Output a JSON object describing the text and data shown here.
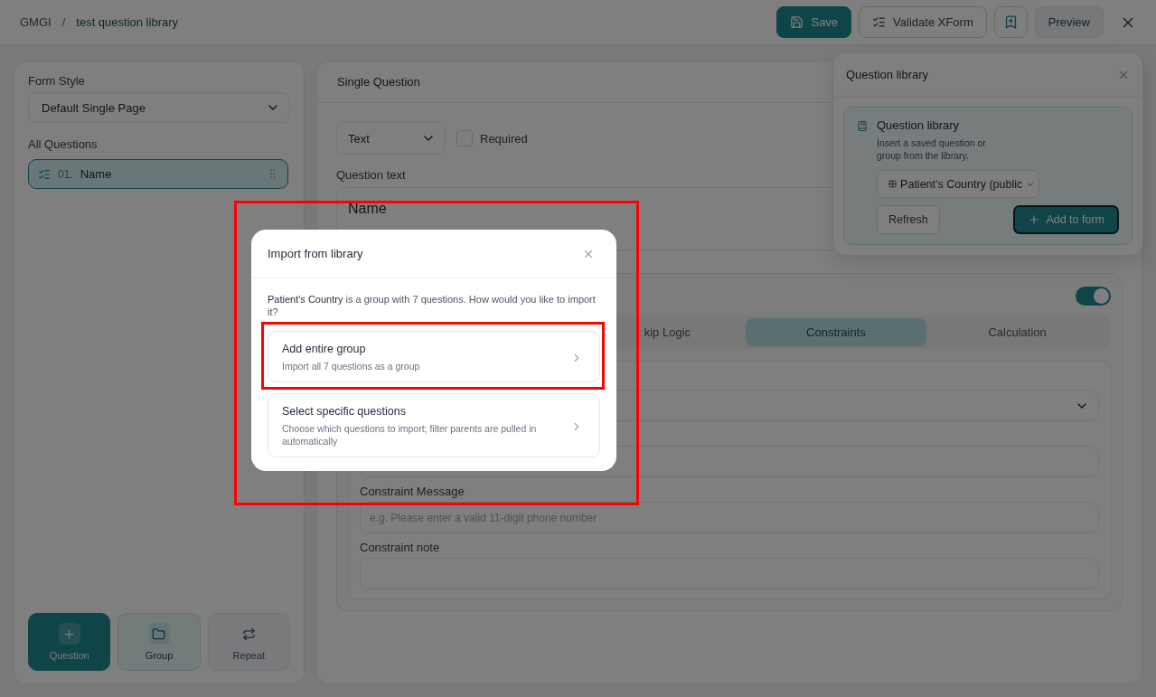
{
  "header": {
    "breadcrumb": [
      {
        "label": "GMGI",
        "current": false
      },
      {
        "label": "test question library",
        "current": true
      }
    ],
    "separator": "/",
    "actions": [
      {
        "kind": "primary",
        "label": "Save"
      },
      {
        "kind": "outline",
        "label": "Validate XForm"
      },
      {
        "kind": "icon"
      },
      {
        "kind": "soft",
        "label": "Preview"
      }
    ]
  },
  "sidebar": {
    "form_style_label": "Form Style",
    "form_style_value": "Default Single Page",
    "questions_label": "All Questions",
    "questions": [
      {
        "number": "01.",
        "label": "Name",
        "selected": true
      }
    ],
    "add_buttons": [
      {
        "kind": "primary",
        "label": "Question"
      },
      {
        "kind": "secondary",
        "label": "Group"
      },
      {
        "kind": "neutral",
        "label": "Repeat"
      }
    ]
  },
  "editor": {
    "title": "Single Question",
    "type_value": "Text",
    "required": {
      "label": "Required",
      "checked": false
    },
    "question_text_label": "Question text",
    "question_text_value": "Name",
    "logic_card": {
      "enabled": true,
      "tabs": [
        {
          "label": "kip Logic",
          "selected": false
        },
        {
          "label": "Constraints",
          "selected": true
        },
        {
          "label": "Calculation",
          "selected": false
        }
      ],
      "fields": [
        {
          "kind": "select"
        },
        {
          "kind": "input"
        },
        {
          "kind": "input",
          "label": "Constraint Message",
          "placeholder": "e.g. Please enter a valid 11-digit phone number"
        },
        {
          "kind": "input",
          "label": "Constraint note"
        }
      ]
    }
  },
  "library_popover": {
    "title": "Question library",
    "card_title": "Question library",
    "description": "Insert a saved question or group from the library.",
    "selected_item": "Patient's Country (public",
    "buttons": [
      {
        "kind": "secondary",
        "label": "Refresh"
      },
      {
        "kind": "primary",
        "label": "Add to form"
      }
    ]
  },
  "modal": {
    "title": "Import from library",
    "message": "**Patient's Country** is a group with 7 questions. How would you like to import it?",
    "options": [
      {
        "title": "Add entire group",
        "description": "Import all 7 questions as a group"
      },
      {
        "title": "Select specific questions",
        "description": "Choose which questions to import; filter parents are pulled in automatically"
      }
    ]
  }
}
